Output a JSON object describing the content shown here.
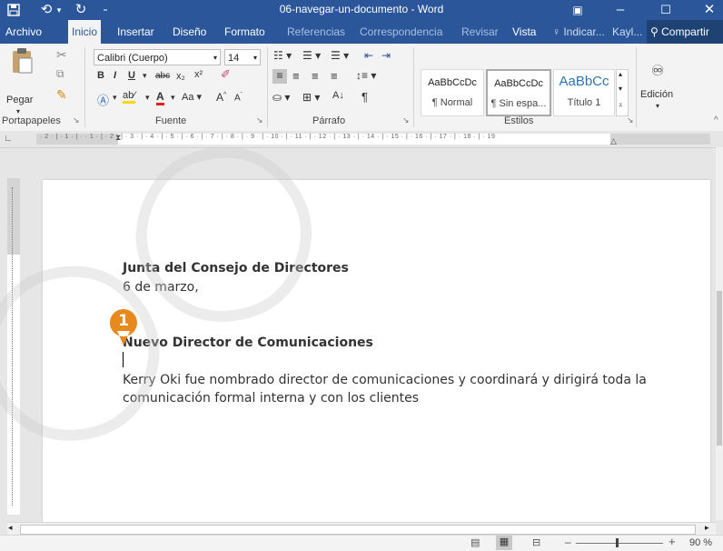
{
  "titlebar": {
    "doc_title": "06-navegar-un-documento - Word"
  },
  "tabs": [
    "Archivo",
    "Inicio",
    "Insertar",
    "Diseño",
    "Formato",
    "Referencias",
    "Correspondencia",
    "Revisar",
    "Vista"
  ],
  "tell_me": "Indicar...",
  "user": "Kayl...",
  "share": "Compartir",
  "ribbon": {
    "paste_label": "Pegar",
    "font_name": "Calibri (Cuerpo)",
    "font_size": "14",
    "styles": [
      {
        "sample": "AaBbCcDc",
        "name": "¶ Normal"
      },
      {
        "sample": "AaBbCcDc",
        "name": "¶ Sin espa..."
      },
      {
        "sample": "AaBbCc",
        "name": "Título 1"
      }
    ],
    "edit_label": "Edición",
    "groups": [
      "Portapapeles",
      "Fuente",
      "Párrafo",
      "Estilos"
    ]
  },
  "ruler": {
    "marks": "· 2 · | · 1 · | · · 1 · | · 2 · | · 3 · | · 4 · | · 5 · | · 6 · | · 7 · | · 8 · | · 9 · | · 10 · | · 11 · | · 12 · | · 13 · | · 14 · | · 15 · | · 16 · | · 17 · | · 18 · | · 19"
  },
  "document": {
    "line1": "Junta del Consejo de Directores",
    "line2": "6 de marzo,",
    "heading": "Nuevo Director de Comunicaciones",
    "para1": "Kerry Oki fue nombrado director de comunicaciones y coordinará y dirigirá toda la",
    "para2": "comunicación formal interna y con los clientes"
  },
  "callout_number": "1",
  "status": {
    "zoom": "90 %"
  },
  "colors": {
    "word_blue": "#2b579a",
    "callout": "#e8891d"
  }
}
